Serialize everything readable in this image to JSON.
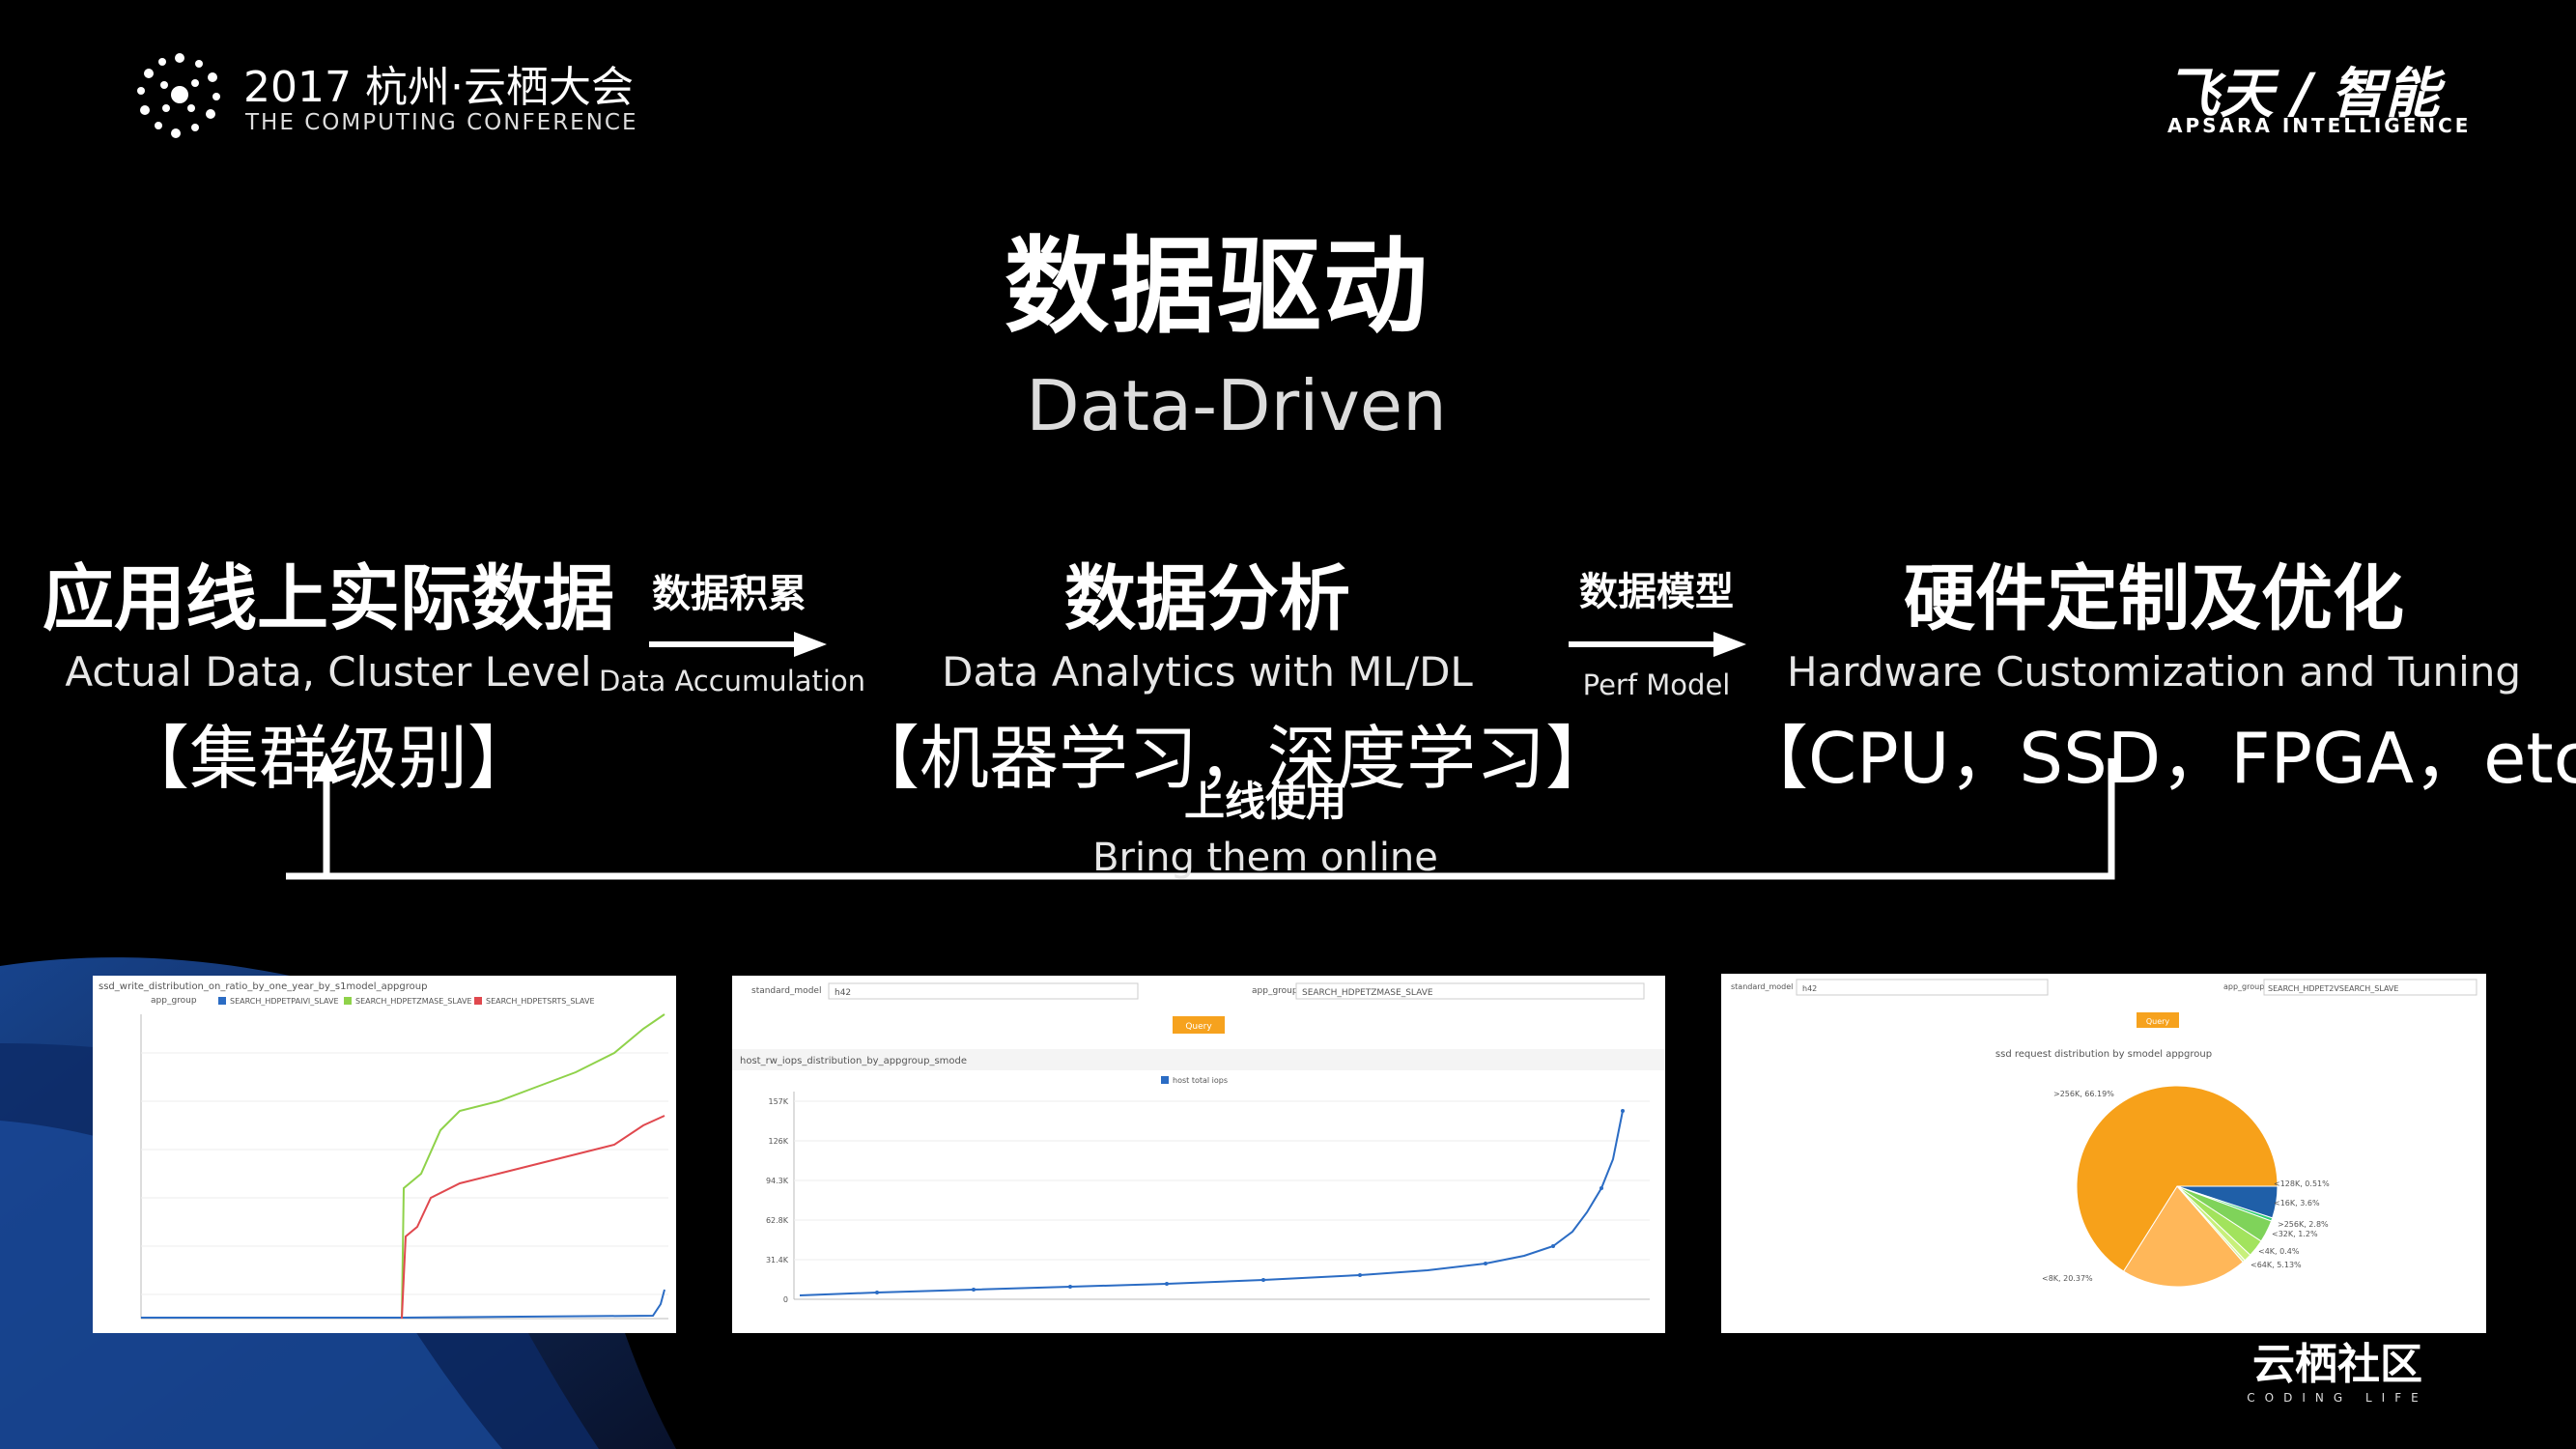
{
  "header": {
    "conf_title": "2017 杭州·云栖大会",
    "conf_subtitle": "THE COMPUTING CONFERENCE",
    "brand_cn": "飞天 / 智能",
    "brand_en": "APSARA INTELLIGENCE"
  },
  "title": {
    "cn": "数据驱动",
    "en": "Data-Driven"
  },
  "flow": {
    "left": {
      "cn": "应用线上实际数据",
      "en": "Actual Data, Cluster Level",
      "bracket": "【集群级别】"
    },
    "arrow1": {
      "cn": "数据积累",
      "en": "Data Accumulation"
    },
    "middle": {
      "cn": "数据分析",
      "en": "Data Analytics with ML/DL",
      "bracket": "【机器学习，深度学习】"
    },
    "arrow2": {
      "cn": "数据模型",
      "en": "Perf Model"
    },
    "right": {
      "cn": "硬件定制及优化",
      "en": "Hardware Customization and Tuning",
      "bracket": "【CPU，SSD，FPGA，etc】"
    },
    "feedback": {
      "cn": "上线使用",
      "en": "Bring them online"
    }
  },
  "screenshots": [
    {
      "title": "ssd_write_distribution_on_ratio_by_one_year_by_s1model_appgroup",
      "legend": [
        "SEARCH_HDPETPAIVI_SLAVE",
        "SEARCH_HDPETZMASE_SLAVE",
        "SEARCH_HDPETSRTS_SLAVE"
      ],
      "legend_label": "app_group"
    },
    {
      "field1": "standard_model",
      "value1": "h42",
      "field2": "app_group",
      "value2": "SEARCH_HDPETZMASE_SLAVE",
      "button": "Query",
      "title": "host_rw_iops_distribution_by_appgroup_smode",
      "legend": "host total iops",
      "y_ticks": [
        "157K",
        "126K",
        "94.3K",
        "62.8K",
        "31.4K",
        "0"
      ]
    },
    {
      "field1": "standard_model",
      "value1": "h42",
      "field2": "app_group",
      "value2": "SEARCH_HDPET2VSEARCH_SLAVE",
      "button": "Query",
      "title": "ssd request distribution by smodel appgroup",
      "slices": [
        {
          "label": ">256K",
          "value": 66.19,
          "color": "#f7a11a"
        },
        {
          "label": "<8K",
          "value": 20.37,
          "color": "#ffb759"
        },
        {
          "label": "<128K",
          "value": 0.51,
          "color": "#2ecc71"
        },
        {
          "label": "<16K",
          "value": 3.6,
          "color": "#7fd35a"
        },
        {
          "label": ">256K",
          "value": 2.8,
          "color": "#a2e35d"
        },
        {
          "label": "<32K",
          "value": 1.2,
          "color": "#c8f07a"
        },
        {
          "label": "<4K",
          "value": 0.4,
          "color": "#d4f3a0"
        },
        {
          "label": "<64K",
          "value": 5.13,
          "color": "#1f5fa8"
        }
      ],
      "pie_labels": [
        ">256K, 66.19%",
        "<8K, 20.37%",
        "<128K, 0.51%",
        "<16K, 3.6%",
        ">256K, 2.8%",
        "<32K, 1.2%",
        "<4K, 0.4%",
        "<64K, 5.13%"
      ]
    }
  ],
  "footer": {
    "brand_cn": "云栖社区",
    "brand_en": "CODING LIFE"
  }
}
